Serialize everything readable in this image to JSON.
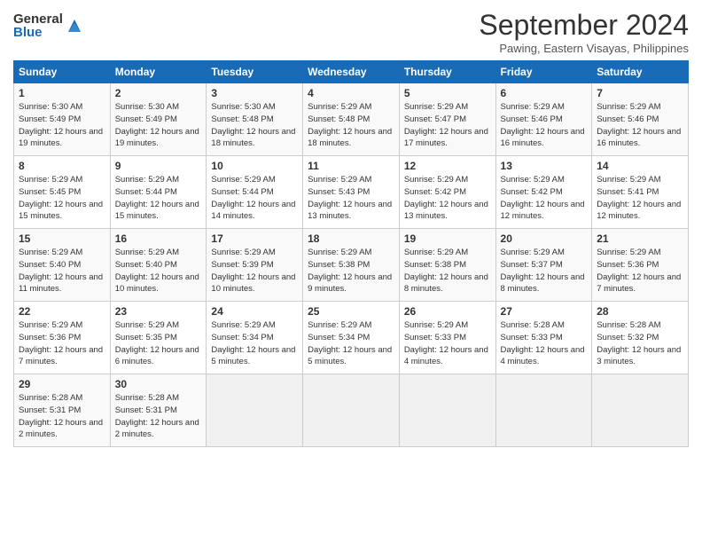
{
  "header": {
    "logo_general": "General",
    "logo_blue": "Blue",
    "month_title": "September 2024",
    "location": "Pawing, Eastern Visayas, Philippines"
  },
  "weekdays": [
    "Sunday",
    "Monday",
    "Tuesday",
    "Wednesday",
    "Thursday",
    "Friday",
    "Saturday"
  ],
  "weeks": [
    [
      {
        "day": "1",
        "sunrise": "Sunrise: 5:30 AM",
        "sunset": "Sunset: 5:49 PM",
        "daylight": "Daylight: 12 hours and 19 minutes."
      },
      {
        "day": "2",
        "sunrise": "Sunrise: 5:30 AM",
        "sunset": "Sunset: 5:49 PM",
        "daylight": "Daylight: 12 hours and 19 minutes."
      },
      {
        "day": "3",
        "sunrise": "Sunrise: 5:30 AM",
        "sunset": "Sunset: 5:48 PM",
        "daylight": "Daylight: 12 hours and 18 minutes."
      },
      {
        "day": "4",
        "sunrise": "Sunrise: 5:29 AM",
        "sunset": "Sunset: 5:48 PM",
        "daylight": "Daylight: 12 hours and 18 minutes."
      },
      {
        "day": "5",
        "sunrise": "Sunrise: 5:29 AM",
        "sunset": "Sunset: 5:47 PM",
        "daylight": "Daylight: 12 hours and 17 minutes."
      },
      {
        "day": "6",
        "sunrise": "Sunrise: 5:29 AM",
        "sunset": "Sunset: 5:46 PM",
        "daylight": "Daylight: 12 hours and 16 minutes."
      },
      {
        "day": "7",
        "sunrise": "Sunrise: 5:29 AM",
        "sunset": "Sunset: 5:46 PM",
        "daylight": "Daylight: 12 hours and 16 minutes."
      }
    ],
    [
      {
        "day": "8",
        "sunrise": "Sunrise: 5:29 AM",
        "sunset": "Sunset: 5:45 PM",
        "daylight": "Daylight: 12 hours and 15 minutes."
      },
      {
        "day": "9",
        "sunrise": "Sunrise: 5:29 AM",
        "sunset": "Sunset: 5:44 PM",
        "daylight": "Daylight: 12 hours and 15 minutes."
      },
      {
        "day": "10",
        "sunrise": "Sunrise: 5:29 AM",
        "sunset": "Sunset: 5:44 PM",
        "daylight": "Daylight: 12 hours and 14 minutes."
      },
      {
        "day": "11",
        "sunrise": "Sunrise: 5:29 AM",
        "sunset": "Sunset: 5:43 PM",
        "daylight": "Daylight: 12 hours and 13 minutes."
      },
      {
        "day": "12",
        "sunrise": "Sunrise: 5:29 AM",
        "sunset": "Sunset: 5:42 PM",
        "daylight": "Daylight: 12 hours and 13 minutes."
      },
      {
        "day": "13",
        "sunrise": "Sunrise: 5:29 AM",
        "sunset": "Sunset: 5:42 PM",
        "daylight": "Daylight: 12 hours and 12 minutes."
      },
      {
        "day": "14",
        "sunrise": "Sunrise: 5:29 AM",
        "sunset": "Sunset: 5:41 PM",
        "daylight": "Daylight: 12 hours and 12 minutes."
      }
    ],
    [
      {
        "day": "15",
        "sunrise": "Sunrise: 5:29 AM",
        "sunset": "Sunset: 5:40 PM",
        "daylight": "Daylight: 12 hours and 11 minutes."
      },
      {
        "day": "16",
        "sunrise": "Sunrise: 5:29 AM",
        "sunset": "Sunset: 5:40 PM",
        "daylight": "Daylight: 12 hours and 10 minutes."
      },
      {
        "day": "17",
        "sunrise": "Sunrise: 5:29 AM",
        "sunset": "Sunset: 5:39 PM",
        "daylight": "Daylight: 12 hours and 10 minutes."
      },
      {
        "day": "18",
        "sunrise": "Sunrise: 5:29 AM",
        "sunset": "Sunset: 5:38 PM",
        "daylight": "Daylight: 12 hours and 9 minutes."
      },
      {
        "day": "19",
        "sunrise": "Sunrise: 5:29 AM",
        "sunset": "Sunset: 5:38 PM",
        "daylight": "Daylight: 12 hours and 8 minutes."
      },
      {
        "day": "20",
        "sunrise": "Sunrise: 5:29 AM",
        "sunset": "Sunset: 5:37 PM",
        "daylight": "Daylight: 12 hours and 8 minutes."
      },
      {
        "day": "21",
        "sunrise": "Sunrise: 5:29 AM",
        "sunset": "Sunset: 5:36 PM",
        "daylight": "Daylight: 12 hours and 7 minutes."
      }
    ],
    [
      {
        "day": "22",
        "sunrise": "Sunrise: 5:29 AM",
        "sunset": "Sunset: 5:36 PM",
        "daylight": "Daylight: 12 hours and 7 minutes."
      },
      {
        "day": "23",
        "sunrise": "Sunrise: 5:29 AM",
        "sunset": "Sunset: 5:35 PM",
        "daylight": "Daylight: 12 hours and 6 minutes."
      },
      {
        "day": "24",
        "sunrise": "Sunrise: 5:29 AM",
        "sunset": "Sunset: 5:34 PM",
        "daylight": "Daylight: 12 hours and 5 minutes."
      },
      {
        "day": "25",
        "sunrise": "Sunrise: 5:29 AM",
        "sunset": "Sunset: 5:34 PM",
        "daylight": "Daylight: 12 hours and 5 minutes."
      },
      {
        "day": "26",
        "sunrise": "Sunrise: 5:29 AM",
        "sunset": "Sunset: 5:33 PM",
        "daylight": "Daylight: 12 hours and 4 minutes."
      },
      {
        "day": "27",
        "sunrise": "Sunrise: 5:28 AM",
        "sunset": "Sunset: 5:33 PM",
        "daylight": "Daylight: 12 hours and 4 minutes."
      },
      {
        "day": "28",
        "sunrise": "Sunrise: 5:28 AM",
        "sunset": "Sunset: 5:32 PM",
        "daylight": "Daylight: 12 hours and 3 minutes."
      }
    ],
    [
      {
        "day": "29",
        "sunrise": "Sunrise: 5:28 AM",
        "sunset": "Sunset: 5:31 PM",
        "daylight": "Daylight: 12 hours and 2 minutes."
      },
      {
        "day": "30",
        "sunrise": "Sunrise: 5:28 AM",
        "sunset": "Sunset: 5:31 PM",
        "daylight": "Daylight: 12 hours and 2 minutes."
      },
      null,
      null,
      null,
      null,
      null
    ]
  ]
}
